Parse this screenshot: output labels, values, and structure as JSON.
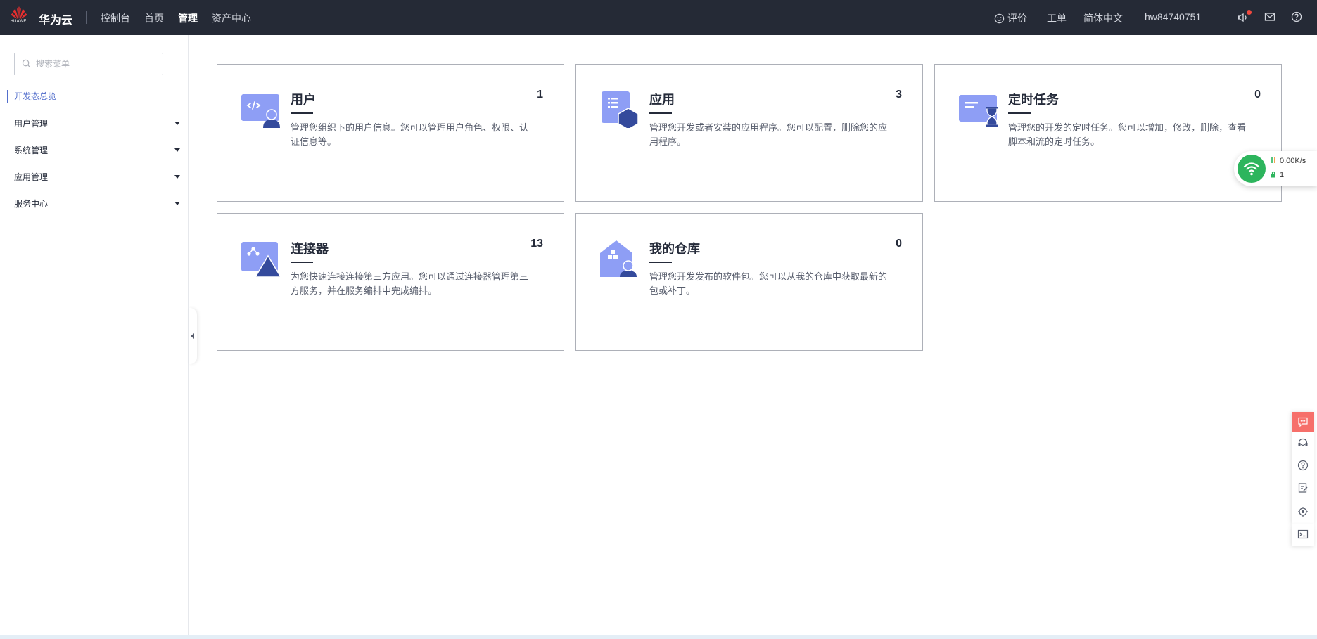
{
  "topbar": {
    "brand": "华为云",
    "logo_text": "HUAWEI",
    "nav": [
      {
        "label": "控制台"
      },
      {
        "label": "首页"
      },
      {
        "label": "管理"
      },
      {
        "label": "资产中心"
      }
    ],
    "feedback_label": "评价",
    "ticket_label": "工单",
    "language_label": "简体中文",
    "username": "hw84740751",
    "icons": [
      "notification-icon",
      "mail-icon",
      "help-icon"
    ]
  },
  "sidebar": {
    "search_placeholder": "搜索菜单",
    "active_item": "开发态总览",
    "items": [
      {
        "label": "用户管理"
      },
      {
        "label": "系统管理"
      },
      {
        "label": "应用管理"
      },
      {
        "label": "服务中心"
      }
    ]
  },
  "cards": [
    {
      "title": "用户",
      "count": "1",
      "desc": "管理您组织下的用户信息。您可以管理用户角色、权限、认证信息等。",
      "icon": "user-icon"
    },
    {
      "title": "应用",
      "count": "3",
      "desc": "管理您开发或者安装的应用程序。您可以配置，删除您的应用程序。",
      "icon": "app-icon"
    },
    {
      "title": "定时任务",
      "count": "0",
      "desc": "管理您的开发的定时任务。您可以增加，修改，删除，查看脚本和流的定时任务。",
      "icon": "scheduled-task-icon"
    },
    {
      "title": "连接器",
      "count": "13",
      "desc": "为您快速连接连接第三方应用。您可以通过连接器管理第三方服务，并在服务编排中完成编排。",
      "icon": "connector-icon"
    },
    {
      "title": "我的仓库",
      "count": "0",
      "desc": "管理您开发发布的软件包。您可以从我的仓库中获取最新的包或补丁。",
      "icon": "repository-icon"
    }
  ],
  "network_widget": {
    "speed": "0.00K/s",
    "connections": "1"
  },
  "colors": {
    "topbar_bg": "#252a36",
    "accent": "#526ecc",
    "card_icon_light": "#8e9ef5",
    "card_icon_dark": "#344a9c",
    "wifi_green": "#2db55d",
    "float_red": "#f66f6a"
  }
}
